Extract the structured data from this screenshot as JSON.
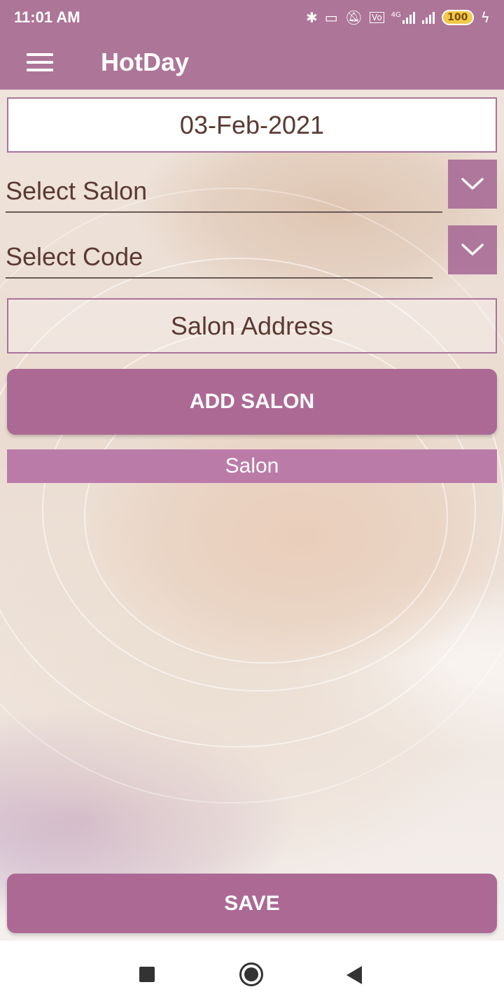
{
  "status_bar": {
    "time": "11:01 AM",
    "battery": "100",
    "network_label": "4G"
  },
  "app_bar": {
    "title": "HotDay",
    "menu_icon": "hamburger-menu-icon"
  },
  "form": {
    "date_value": "03-Feb-2021",
    "select_salon_placeholder": "Select Salon",
    "select_code_placeholder": "Select Code",
    "salon_address_placeholder": "Salon Address",
    "add_salon_label": "ADD SALON",
    "salon_list_header": "Salon",
    "save_label": "SAVE"
  },
  "colors": {
    "accent": "#ad7598",
    "button": "#ac6994",
    "list_header": "#bb7ba9",
    "text": "#5a3a32"
  },
  "navigation_bar": {
    "icons": [
      "recents-square-icon",
      "home-circle-icon",
      "back-triangle-icon"
    ]
  }
}
